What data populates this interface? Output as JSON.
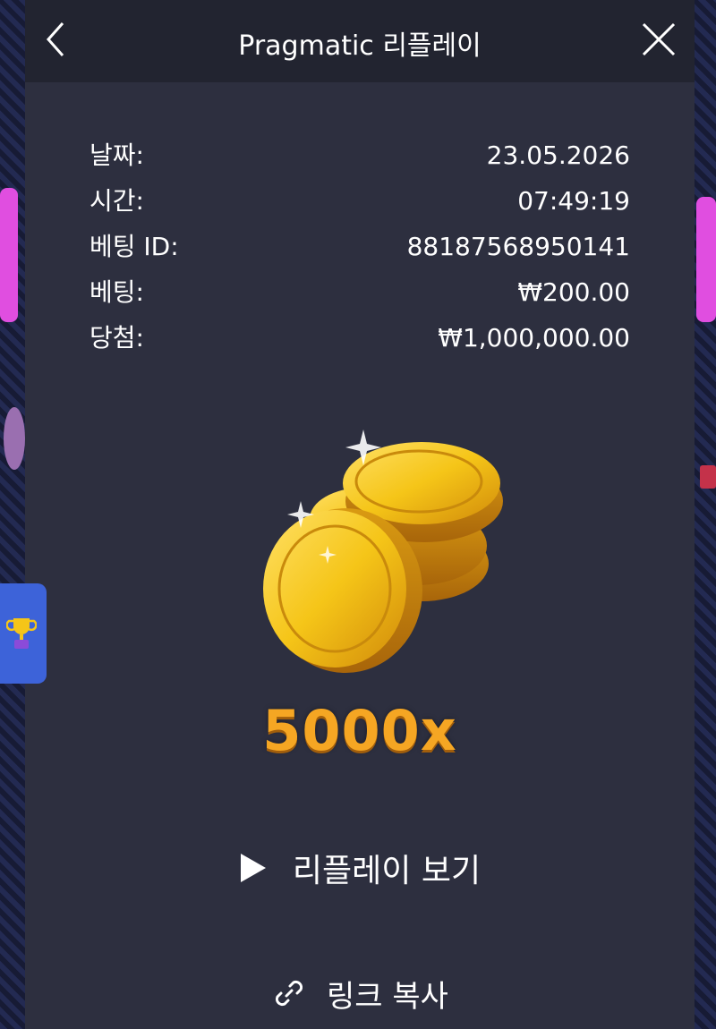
{
  "header": {
    "title": "Pragmatic 리플레이",
    "back_icon": "chevron-left-icon",
    "close_icon": "close-icon"
  },
  "details": [
    {
      "label": "날짜:",
      "value": "23.05.2026"
    },
    {
      "label": "시간:",
      "value": "07:49:19"
    },
    {
      "label": "베팅 ID:",
      "value": "88187568950141"
    },
    {
      "label": "베팅:",
      "value": "₩200.00"
    },
    {
      "label": "당첨:",
      "value": "₩1,000,000.00"
    }
  ],
  "win": {
    "multiplier": "5000x",
    "image": "gold-coins-icon"
  },
  "actions": {
    "replay_label": "리플레이 보기",
    "replay_icon": "play-icon",
    "copy_link_label": "링크 복사",
    "copy_link_icon": "link-icon"
  },
  "side_tab": {
    "icon": "trophy-icon"
  },
  "colors": {
    "panel_bg": "#2d2f3f",
    "header_bg": "#222430",
    "multiplier": "#f5a623",
    "side_tab": "#3d63d9"
  }
}
